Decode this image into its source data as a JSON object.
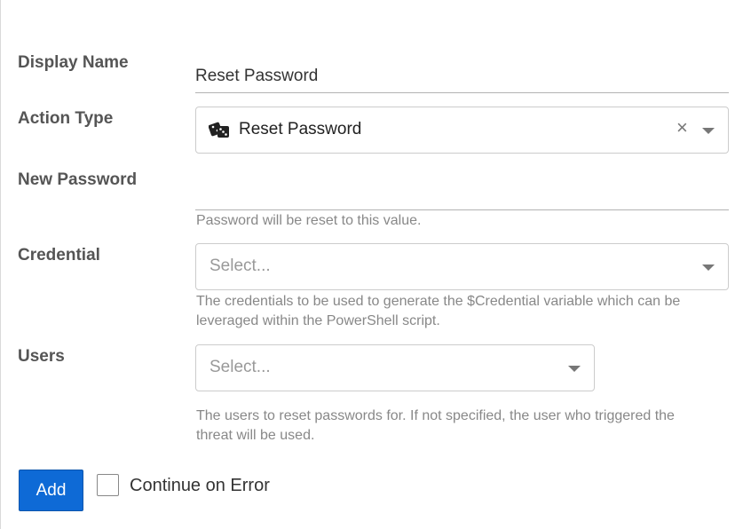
{
  "form": {
    "display_name": {
      "label": "Display Name",
      "value": "Reset Password"
    },
    "action_type": {
      "label": "Action Type",
      "value": "Reset Password",
      "icon": "dice-icon"
    },
    "new_password": {
      "label": "New Password",
      "value": "",
      "help": "Password will be reset to this value."
    },
    "credential": {
      "label": "Credential",
      "placeholder": "Select...",
      "help_line1": "The credentials to be used to generate the $Credential variable which can be",
      "help_line2": "leveraged within the PowerShell script."
    },
    "users": {
      "label": "Users",
      "placeholder": "Select...",
      "help_line1": "The users to reset passwords for. If not specified, the user who triggered the",
      "help_line2": "threat will be used."
    }
  },
  "footer": {
    "add_label": "Add",
    "continue_on_error_label": "Continue on Error",
    "continue_on_error_checked": false
  },
  "colors": {
    "primary": "#0e6ad6",
    "label": "#555555",
    "help": "#888888",
    "border": "#cccccc"
  }
}
